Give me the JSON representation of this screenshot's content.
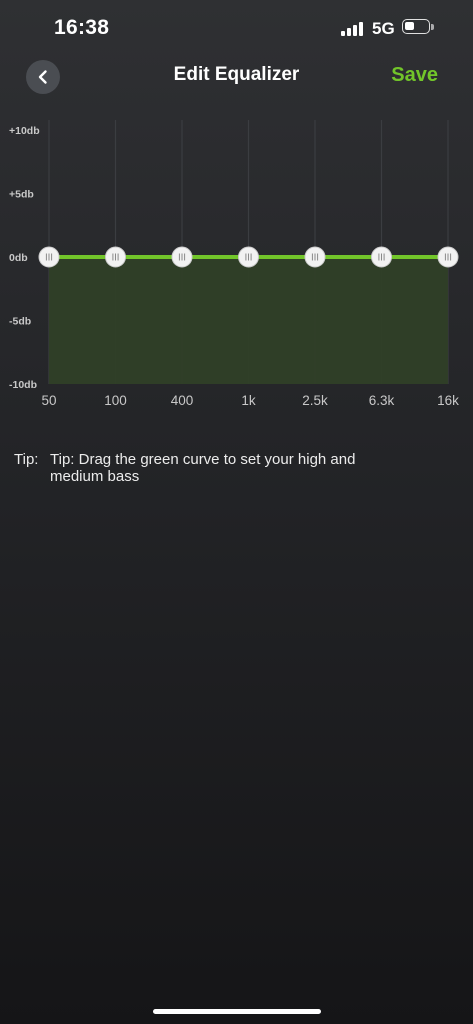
{
  "status_bar": {
    "time": "16:38",
    "network": "5G",
    "signal_bars": 4,
    "battery_level": 0.45
  },
  "header": {
    "back_icon": "chevron-left-icon",
    "title": "Edit Equalizer",
    "save_label": "Save"
  },
  "colors": {
    "accent": "#72c52a",
    "fill": "#2f3f27",
    "grid": "#3b3d41"
  },
  "chart_data": {
    "type": "area",
    "y_tick_labels": [
      "+10db",
      "+5db",
      "0db",
      "-5db",
      "-10db"
    ],
    "y_ticks": [
      10,
      5,
      0,
      -5,
      -10
    ],
    "ylim": [
      -10,
      10
    ],
    "categories": [
      "50",
      "100",
      "400",
      "1k",
      "2.5k",
      "6.3k",
      "16k"
    ],
    "values": [
      0,
      0,
      0,
      0,
      0,
      0,
      0
    ],
    "grid": true
  },
  "tip": {
    "label": "Tip:",
    "text": "Tip: Drag the green curve to set your high and medium bass"
  }
}
